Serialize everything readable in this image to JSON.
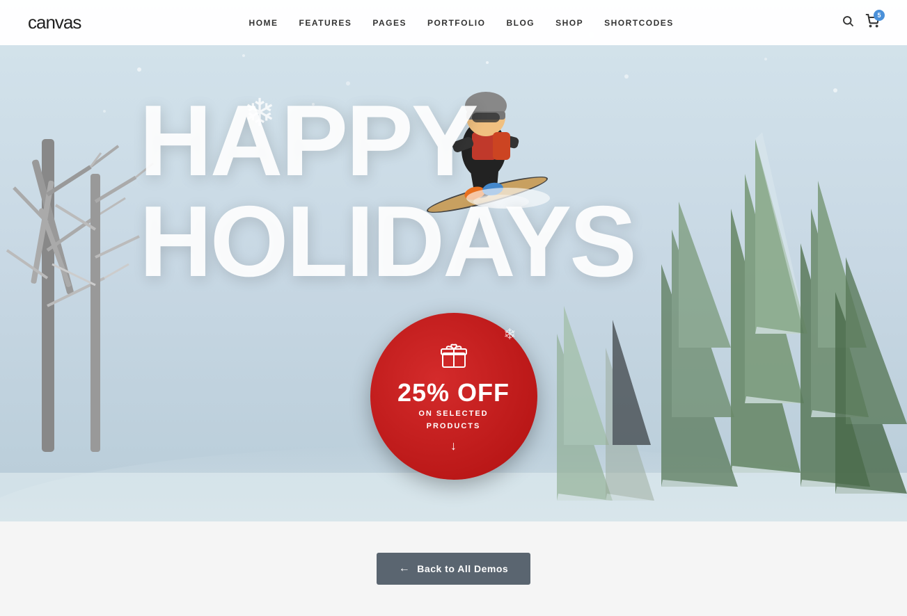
{
  "brand": {
    "logo_text": "canvas"
  },
  "navbar": {
    "links": [
      {
        "label": "HOME",
        "id": "home"
      },
      {
        "label": "FEATURES",
        "id": "features"
      },
      {
        "label": "PAGES",
        "id": "pages"
      },
      {
        "label": "PORTFOLIO",
        "id": "portfolio"
      },
      {
        "label": "BLOG",
        "id": "blog"
      },
      {
        "label": "SHOP",
        "id": "shop"
      },
      {
        "label": "SHORTCODES",
        "id": "shortcodes"
      }
    ],
    "cart_count": "5"
  },
  "hero": {
    "headline_line1": "HAPPY",
    "headline_line2": "HOLIDAYS",
    "snowflake": "❄",
    "dot": "•"
  },
  "promo": {
    "discount": "25% OFF",
    "subtitle_line1": "ON SELECTED",
    "subtitle_line2": "PRODUCTS"
  },
  "footer": {
    "back_button_label": "Back to All Demos"
  }
}
